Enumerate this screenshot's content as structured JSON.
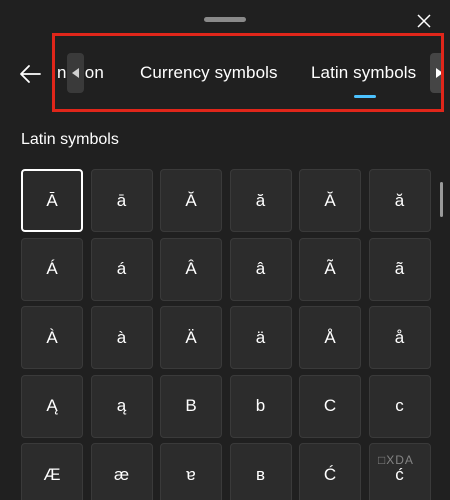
{
  "close_label": "✕",
  "tabs": [
    {
      "label": "nation",
      "state": "partial"
    },
    {
      "label": "Currency symbols",
      "state": "inactive"
    },
    {
      "label": "Latin symbols",
      "state": "active"
    }
  ],
  "section_title": "Latin symbols",
  "symbols": [
    "Ā",
    "ā",
    "Ă",
    "ă",
    "Ӑ",
    "ӑ",
    "Á",
    "á",
    "Â",
    "â",
    "Ã",
    "ã",
    "À",
    "à",
    "Ä",
    "ä",
    "Å",
    "å",
    "Ą",
    "ą",
    "B",
    "b",
    "C",
    "c",
    "Æ",
    "æ",
    "ɐ",
    "ʙ",
    "Ć",
    "ć"
  ],
  "selected_index": 0,
  "icons": {
    "close": "close-icon",
    "back": "back-arrow-icon",
    "scroll_left": "caret-left-icon",
    "scroll_right": "caret-right-icon"
  },
  "colors": {
    "background": "#202020",
    "key": "#2c2c2c",
    "accent": "#4cc2ff",
    "highlight": "#e0261a"
  },
  "watermark": "□XDA"
}
